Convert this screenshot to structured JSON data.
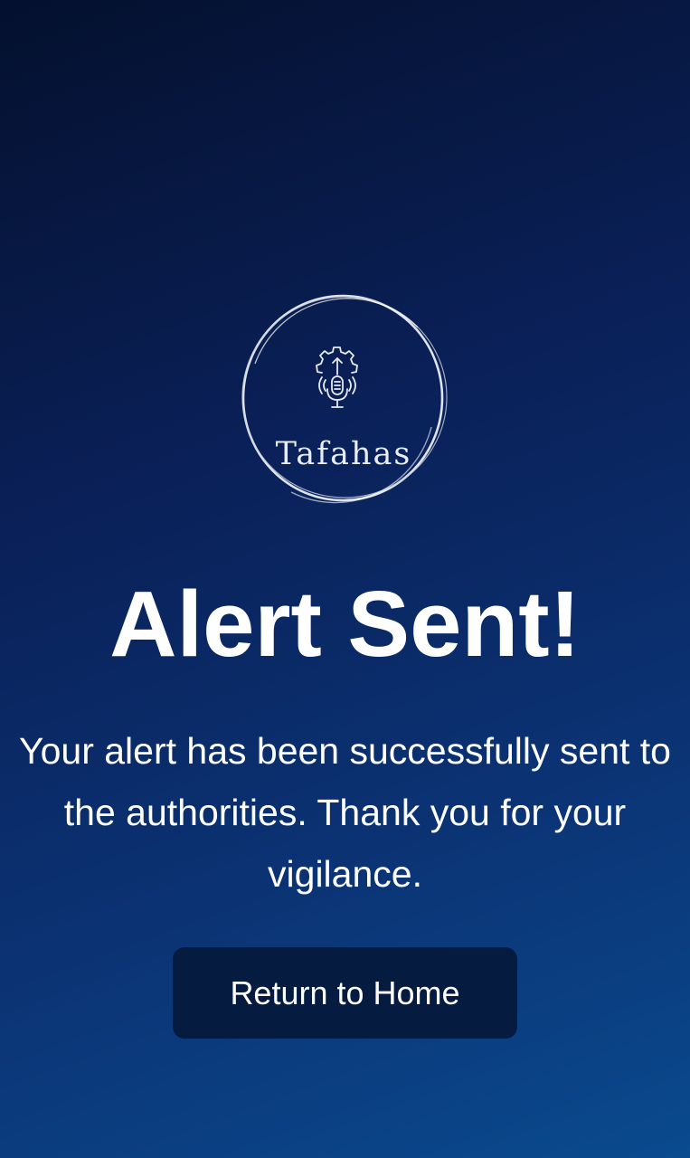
{
  "brand": {
    "name": "Tafahas",
    "logo_icon": "microphone-gear-icon"
  },
  "status": {
    "title": "Alert Sent!",
    "message": "Your alert has been successfully sent to the authorities. Thank you for your vigilance."
  },
  "actions": {
    "home_label": "Return to Home"
  },
  "colors": {
    "background_top": "#04102e",
    "background_bottom": "#0a4a8e",
    "button_bg": "#051c40",
    "text": "#ffffff"
  }
}
